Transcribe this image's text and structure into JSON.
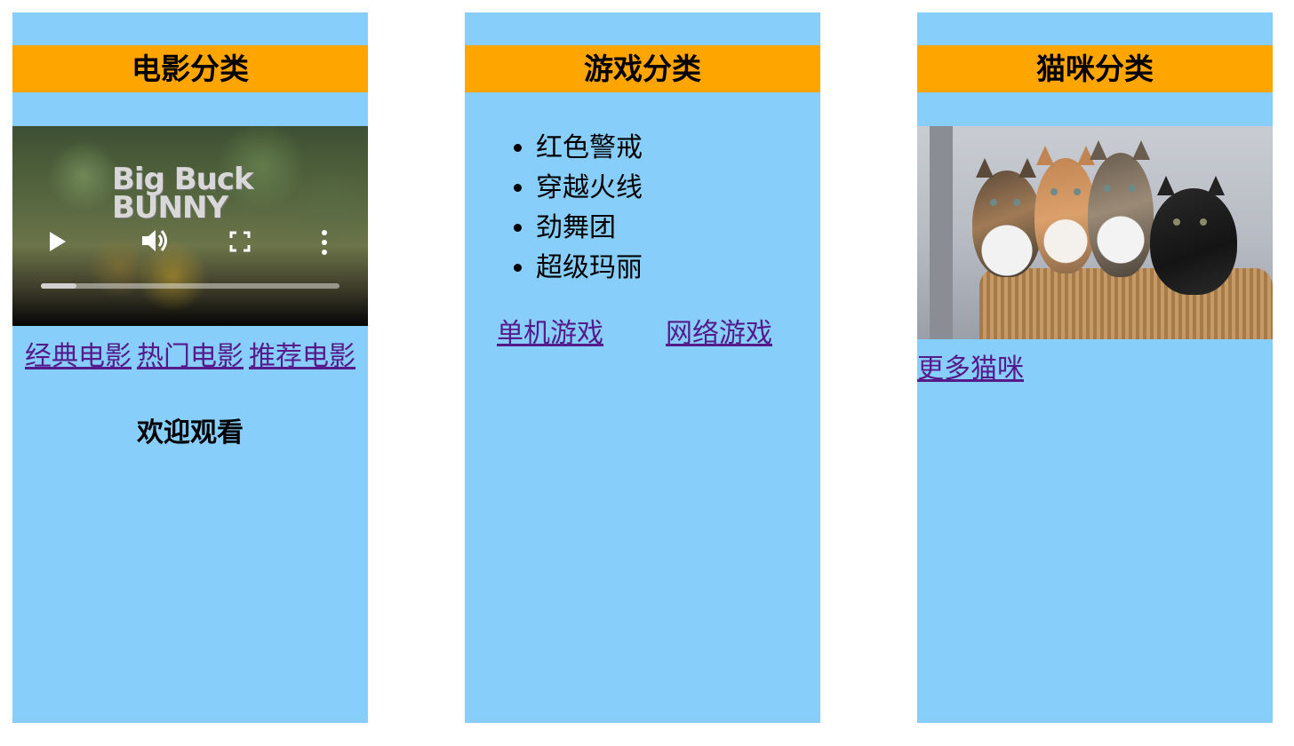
{
  "colors": {
    "panel_bg": "#87cefa",
    "header_bg": "#ffa500",
    "link": "#551a8b"
  },
  "movies": {
    "heading": "电影分类",
    "video": {
      "title_art": "Big Buck BUNNY",
      "progress_fraction": 0.12,
      "icons": [
        "play-icon",
        "volume-icon",
        "fullscreen-icon",
        "more-options-icon"
      ]
    },
    "links": [
      "经典电影",
      "热门电影",
      "推荐电影"
    ],
    "welcome": "欢迎观看"
  },
  "games": {
    "heading": "游戏分类",
    "items": [
      "红色警戒",
      "穿越火线",
      "劲舞团",
      "超级玛丽"
    ],
    "links": [
      "单机游戏",
      "网络游戏"
    ]
  },
  "cats": {
    "heading": "猫咪分类",
    "photo": "kittens-in-basket",
    "link": "更多猫咪"
  }
}
